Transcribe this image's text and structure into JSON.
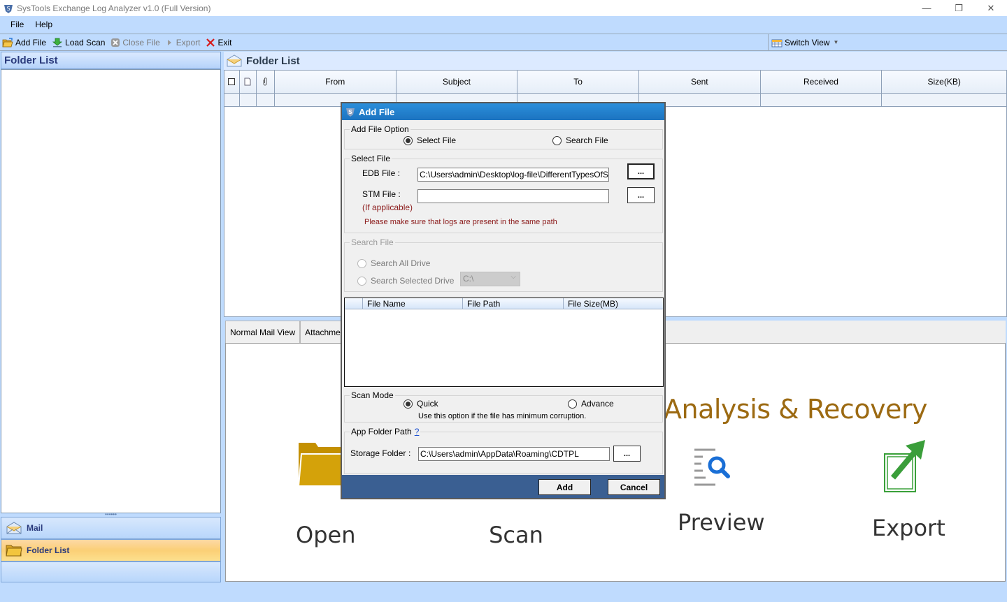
{
  "window": {
    "title": "SysTools Exchange Log Analyzer v1.0 (Full Version)",
    "controls": {
      "minimize": "—",
      "restore": "❐",
      "close": "✕"
    }
  },
  "menu": {
    "items": [
      "File",
      "Help"
    ]
  },
  "toolbar": {
    "add_file": "Add File",
    "load_scan": "Load Scan",
    "close_file": "Close File",
    "export": "Export",
    "exit": "Exit",
    "switch_view": "Switch View"
  },
  "left_pane": {
    "header": "Folder List",
    "nav": {
      "mail": "Mail",
      "folder_list": "Folder List"
    },
    "splitter_glyph": "••••••"
  },
  "right_pane": {
    "header": "Folder List",
    "columns": [
      "From",
      "Subject",
      "To",
      "Sent",
      "Received",
      "Size(KB)"
    ]
  },
  "bottom_pane": {
    "tabs": [
      "Normal Mail View",
      "Attachment"
    ],
    "brand_title": "Analysis & Recovery",
    "steps": [
      "Open",
      "Scan",
      "Preview",
      "Export"
    ]
  },
  "dialog": {
    "title": "Add File",
    "add_file_option": {
      "legend": "Add File Option",
      "select_file": "Select File",
      "search_file": "Search File",
      "selected": "select_file"
    },
    "select_file": {
      "legend": "Select File",
      "edb_label": "EDB File :",
      "edb_value": "C:\\Users\\admin\\Desktop\\log-file\\DifferentTypesOfSamp",
      "stm_label": "STM File :",
      "stm_value": "",
      "stm_note": "(If applicable)",
      "browse": "...",
      "warning": "Please make sure that logs are present in the same path"
    },
    "search_file": {
      "legend": "Search File",
      "all_drive": "Search All Drive",
      "selected_drive": "Search Selected Drive",
      "drive_value": "C:\\"
    },
    "file_list": {
      "columns": [
        "File Name",
        "File Path",
        "File Size(MB)"
      ]
    },
    "scan_mode": {
      "legend": "Scan Mode",
      "quick": "Quick",
      "advance": "Advance",
      "selected": "quick",
      "hint": "Use this option if the file has minimum corruption."
    },
    "app_folder": {
      "legend": "App Folder Path",
      "help": "?",
      "storage_label": "Storage Folder",
      "colon": ":",
      "storage_value": "C:\\Users\\admin\\AppData\\Roaming\\CDTPL",
      "browse": "..."
    },
    "buttons": {
      "add": "Add",
      "cancel": "Cancel"
    }
  }
}
